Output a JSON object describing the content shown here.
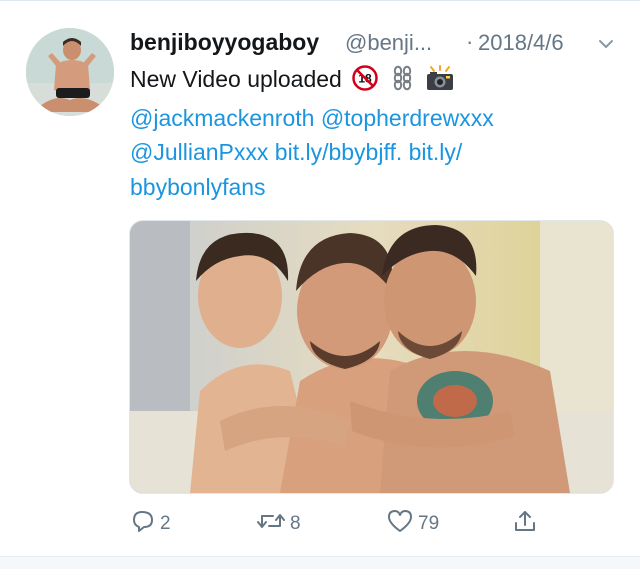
{
  "tweet": {
    "author_name": "benjiboyyogaboy",
    "author_handle": "@benji...",
    "separator": "·",
    "date": "2018/4/6",
    "text_line1": "New Video uploaded",
    "text_line2_a": "@jackmackenroth",
    "text_line2_b": "@topherdrewxxx",
    "text_line3_a": "@JullianPxxx",
    "text_line3_b": "bit.ly/bbybjff.",
    "text_line3_c": "bit.ly/",
    "text_line4": "bbybonlyfans",
    "emojis": [
      "no-under-18-icon",
      "chains-icon",
      "camera-flash-icon"
    ]
  },
  "actions": {
    "reply_count": "2",
    "retweet_count": "8",
    "like_count": "79"
  },
  "colors": {
    "link": "#1b95e0",
    "muted": "#657786",
    "text": "#14171a"
  }
}
